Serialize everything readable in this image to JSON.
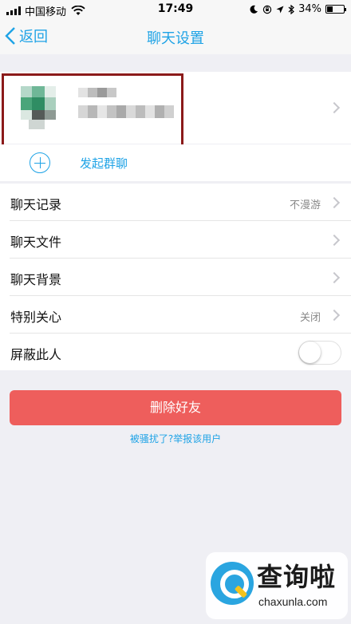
{
  "status_bar": {
    "carrier": "中国移动",
    "time": "17:49",
    "battery_percent": "34%",
    "battery_level": 0.34,
    "icons": [
      "signal-icon",
      "wifi-icon",
      "moon-icon",
      "orientation-lock-icon",
      "location-icon",
      "bluetooth-icon",
      "battery-icon"
    ]
  },
  "nav": {
    "back_label": "返回",
    "title": "聊天设置"
  },
  "group_chat": {
    "label": "发起群聊"
  },
  "settings": {
    "rows": [
      {
        "label": "聊天记录",
        "value": "不漫游"
      },
      {
        "label": "聊天文件",
        "value": ""
      },
      {
        "label": "聊天背景",
        "value": ""
      },
      {
        "label": "特别关心",
        "value": "关闭"
      },
      {
        "label": "屏蔽此人",
        "toggle_on": false
      }
    ]
  },
  "delete_button": {
    "label": "删除好友"
  },
  "report_link": {
    "label": "被骚扰了?举报该用户"
  },
  "watermark": {
    "text": "查询啦",
    "url": "chaxunla.com"
  },
  "colors": {
    "accent": "#1fa3e6",
    "danger": "#ee5e5c",
    "highlight_border": "#8b1a1a",
    "background": "#efeff4"
  }
}
